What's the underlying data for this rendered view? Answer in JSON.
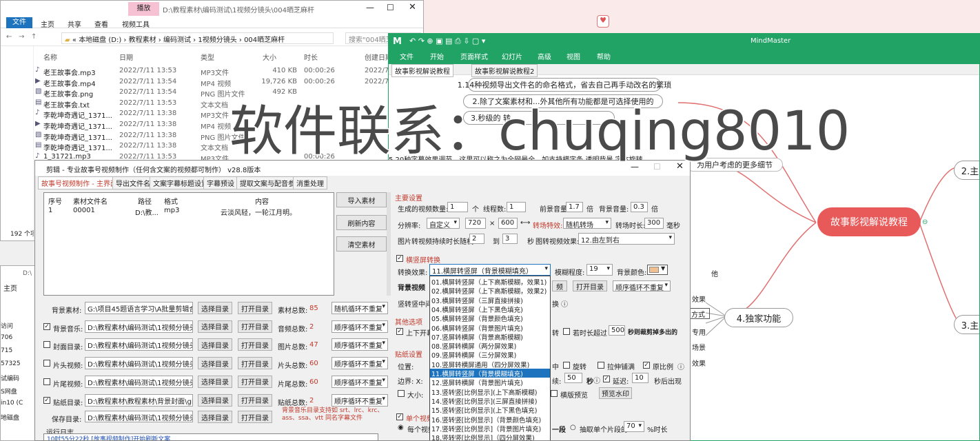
{
  "explorer": {
    "ribbon_tab_active": "文件",
    "ribbon_tabs": [
      "主页",
      "共享",
      "查看"
    ],
    "context_group": "播放",
    "context_tab": "视频工具",
    "title_path": "D:\\教程素材\\编码测试\\1视频分镜头\\004晒芝麻杆",
    "breadcrumb": [
      "本地磁盘 (D:)",
      "教程素材",
      "编码测试",
      "1视频分镜头",
      "004晒芝麻杆"
    ],
    "search_placeholder": "搜索\"004晒芝...",
    "columns": [
      "名称",
      "日期",
      "类型",
      "大小",
      "时长",
      "创建日期"
    ],
    "files": [
      {
        "name": "老王故事会.mp3",
        "date": "2022/7/11 13:53",
        "type": "MP3文件",
        "size": "410 KB",
        "len": "00:00:26",
        "created": "2022/7/"
      },
      {
        "name": "老王故事会.mp4",
        "date": "2022/7/11 13:54",
        "type": "MP4 视频",
        "size": "19,726 KB",
        "len": "00:00:26",
        "created": "2022/7/"
      },
      {
        "name": "老王故事会.png",
        "date": "2022/7/11 13:54",
        "type": "PNG 图片文件",
        "size": "492 KB",
        "len": "",
        "created": ""
      },
      {
        "name": "老王故事会.txt",
        "date": "2022/7/11 13:53",
        "type": "文本文档",
        "size": "",
        "len": "",
        "created": ""
      },
      {
        "name": "李乾坤奇遇记_1371...",
        "date": "2022/7/11 13:38",
        "type": "MP3文件",
        "size": "",
        "len": "",
        "created": ""
      },
      {
        "name": "李乾坤奇遇记_1371...",
        "date": "2022/7/11 13:38",
        "type": "MP4 视频",
        "size": "",
        "len": "",
        "created": ""
      },
      {
        "name": "李乾坤奇遇记_1371...",
        "date": "2022/7/11 13:38",
        "type": "PNG 图片文件",
        "size": "",
        "len": "",
        "created": ""
      },
      {
        "name": "李乾坤奇遇记_1371...",
        "date": "2022/7/11 13:38",
        "type": "文本文档",
        "size": "",
        "len": "",
        "created": ""
      },
      {
        "name": "1_31721.mp3",
        "date": "2022/7/11 13:53",
        "type": "MP3文件",
        "size": "",
        "len": "00:00:26",
        "created": ""
      }
    ],
    "item_count": "192 个项"
  },
  "explorer2": {
    "tab": "主页",
    "path": "D:\\",
    "side_items": [
      "访问",
      "706",
      "715",
      "57325",
      "试编码",
      "S网盘",
      "in10 (C",
      "地磁盘"
    ]
  },
  "mindmaster": {
    "app_title": "MindMaster",
    "menu": [
      "文件",
      "开始",
      "页面样式",
      "幻灯片",
      "高级",
      "视图",
      "帮助"
    ],
    "doc_tabs": [
      "故事影视解说教程",
      "故事影视解说教程2"
    ],
    "central_topic": "故事影视解说教程",
    "nodes": [
      "1.14种视频导出文件名的命名格式，省去自己再手动改名的繁琐",
      "2.除了文案素材和...外其他所有功能都是可选择使用的",
      "3.秒级的 转...",
      "5.20种字幕效果调节，这里可以称之为全网最全，如支持横字条 透明背景 字体旋转",
      "为用户考虑的更多细节",
      "2.主要",
      "3.主要",
      "4.独家功能"
    ],
    "side_nodes": [
      "效果",
      "方式",
      "专用",
      "场景",
      "效果",
      "他"
    ]
  },
  "watermark": "软件联系：chuqing8010",
  "app": {
    "title": "剪辑 - 专业故事号视频制作（任何含文案的视频都可制作）   v28.8版本",
    "tabs": [
      "故事号视频制作 - 主界面",
      "导出文件名",
      "文案字幕标题设置",
      "字幕预设",
      "提取文案与配音参数",
      "消重处理"
    ],
    "list_cols": [
      "序号",
      "素材文件名",
      "路径",
      "格式",
      "内容"
    ],
    "list_row": {
      "no": "1",
      "name": "00001",
      "path": "D:\\教...",
      "fmt": "mp3",
      "content": "云淡风轻，一轮江月明。"
    },
    "list_buttons": [
      "导入素材",
      "刷新内容",
      "清空素材"
    ],
    "dir_rows": [
      {
        "label": "背景素材:",
        "checked": null,
        "path": "G:\\项目45题语言学习\\A批量剪辑合成\\",
        "count_label": "素材总数:",
        "count": "85",
        "mode": "随机循环不重复"
      },
      {
        "label": "背景音乐:",
        "checked": true,
        "path": "D:\\教程素材\\编码测试\\1视频分镜头\\004",
        "count_label": "音频总数:",
        "count": "2",
        "mode": "顺序循环不重复"
      },
      {
        "label": "封面目录:",
        "checked": false,
        "path": "D:\\教程素材\\编码测试\\1视频分镜头\\00",
        "count_label": "图片总数:",
        "count": "47",
        "mode": "顺序循环不重复"
      },
      {
        "label": "片头视频:",
        "checked": false,
        "path": "D:\\教程素材\\编码测试\\1视频分镜头\\00",
        "count_label": "片头总数:",
        "count": "60",
        "mode": "顺序循环不重复"
      },
      {
        "label": "片尾视频:",
        "checked": false,
        "path": "D:\\教程素材\\编码测试\\1视频分镜头\\00",
        "count_label": "片尾总数:",
        "count": "60",
        "mode": "顺序循环不重复"
      },
      {
        "label": "贴纸目录:",
        "checked": true,
        "path": "D:\\教程素材\\教程素材\\背景封面\\gif",
        "count_label": "贴纸总数:",
        "count": "2",
        "mode": "顺序循环不重复"
      }
    ],
    "choose_btn": "选择目录",
    "open_btn": "打开目录",
    "save_label": "保存目录:",
    "save_path": "D:\\教程素材\\编码测试\\1视频分镜头\\00",
    "save_note": "背景音乐目录支持如 srt、lrc、krc、ass、ssa、vtt 同名字幕文件",
    "log_label": "运行日志",
    "log_line": "10时55分22秒 [故事视频制作]开始刷新文案......",
    "params": {
      "section": "主要设置",
      "gen_label": "生成的视频数量:",
      "gen": "1",
      "gen_unit": "个",
      "thread_label": "线程数:",
      "thread": "1",
      "fg_vol_label": "前景音量:",
      "fg_vol": "1.7",
      "bg_vol_label": "背景音量:",
      "bg_vol": "0.3",
      "vol_unit": "倍",
      "res_label": "分辨率:",
      "res": "自定义",
      "w": "720",
      "x": "×",
      "h": "600",
      "trans_label": "转场特效:",
      "trans": "随机转场",
      "trans_time_label": "转场时长:",
      "trans_time": "300",
      "ms": "毫秒",
      "img_label": "图片转视频持续时长随机:",
      "img_min": "2",
      "img_to": "到",
      "img_max": "3",
      "sec": "秒",
      "img_fx_label": "图转视频效果:",
      "img_fx": "12.由左到右",
      "hv_label": "横竖屏转换",
      "conv_label": "转换效果:",
      "conv": "11.横屏转竖屏（背景模糊填充）",
      "blur_label": "模糊程度:",
      "blur": "19",
      "bgc_label": "背景颜色:",
      "bgv_label": "背景视频",
      "mid_label": "竖转竖中间",
      "other_label": "其他选项",
      "top_label": "上下开幕",
      "paste_label": "贴纸设置",
      "pos_label": "位置:",
      "edge_label": "边界: X:",
      "size_label": "大小:",
      "opt_btn": "打开目录",
      "loop_mode": "顺序循环不重复",
      "rotate": "旋转",
      "stretch": "拉伸铺满",
      "ratio": "原比例",
      "delay": "延迟:",
      "delay_v": "10",
      "after": "秒后出现",
      "dur_label": "续:",
      "dur": "50",
      "preview": "横版预览",
      "wm_btn": "预览水印",
      "exceed": "若时长超过",
      "exceed_v": "500",
      "exceed_tail": "秒则裁剪掉多出的",
      "cut_label": "单个视频",
      "cut1": "每个视频",
      "seg": "一段",
      "extract": "抽取单个片段的",
      "pct": "70",
      "pct_tail": "%时长"
    },
    "dropdown": [
      "01.横屏转竖屏（上下高斯模糊，效果1)",
      "02.横屏转竖屏（上下高斯模糊，效果2)",
      "03.横屏转竖屏（三屏直接拼接)",
      "04.横屏转竖屏（上下黑色填充)",
      "05.横屏转竖屏（背景颜色填充)",
      "06.横屏转竖屏（背景图片填充)",
      "07.竖屏转横屏（背景高斯模糊)",
      "08.竖屏转横屏（两分屏效果)",
      "09.竖屏转横屏（三分屏效果)",
      "10.竖屏转横屏通用（四分屏效果)",
      "11.横屏转竖屏（背景模糊填充)",
      "12.竖屏转横屏（背景图片填充)",
      "13.竖转竖[比例显示](上下高斯模糊)",
      "14.竖转竖[比例显示](三屏直接拼接)",
      "15.竖转竖[比例显示](上下黑色填充)",
      "16.竖转竖[比例显示]（背景颜色填充)",
      "17.竖转竖[比例显示]（背景图片填充)",
      "18.竖转竖[比例显示]（四分屏效果)"
    ]
  },
  "colors": {
    "accent": "#1e73be",
    "mind_green": "#21a366",
    "central": "#e85a5a",
    "red": "#c0392b"
  }
}
